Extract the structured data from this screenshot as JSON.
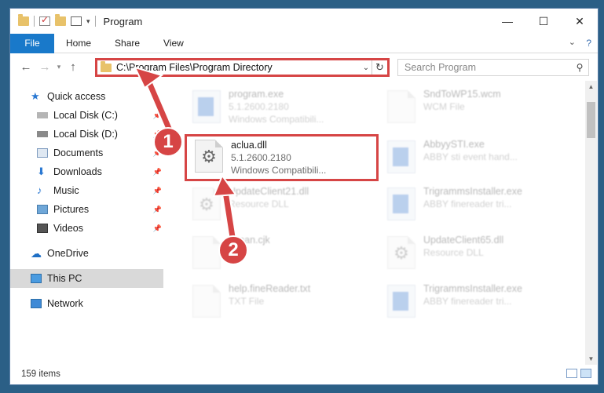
{
  "window": {
    "title": "Program",
    "buttons": {
      "minimize": "—",
      "maximize": "☐",
      "close": "✕"
    }
  },
  "ribbon": {
    "tabs": [
      "File",
      "Home",
      "Share",
      "View"
    ],
    "help": "?"
  },
  "address": {
    "path": "C:\\Program Files\\Program Directory",
    "search_placeholder": "Search Program"
  },
  "sidebar": {
    "items": [
      {
        "label": "Quick access",
        "icon": "star-icon"
      },
      {
        "label": "Local Disk (C:)",
        "icon": "drive-icon"
      },
      {
        "label": "Local Disk (D:)",
        "icon": "drive-icon"
      },
      {
        "label": "Documents",
        "icon": "documents-icon"
      },
      {
        "label": "Downloads",
        "icon": "download-icon"
      },
      {
        "label": "Music",
        "icon": "music-icon"
      },
      {
        "label": "Pictures",
        "icon": "pictures-icon"
      },
      {
        "label": "Videos",
        "icon": "videos-icon"
      },
      {
        "label": "OneDrive",
        "icon": "cloud-icon"
      },
      {
        "label": "This PC",
        "icon": "computer-icon"
      },
      {
        "label": "Network",
        "icon": "network-icon"
      }
    ]
  },
  "files": [
    {
      "name": "program.exe",
      "line1": "5.1.2600.2180",
      "line2": "Windows Compatibili...",
      "kind": "app"
    },
    {
      "name": "SndToWP15.wcm",
      "line1": "WCM File",
      "line2": "",
      "kind": "doc"
    },
    {
      "name": "aclua.dll",
      "line1": "5.1.2600.2180",
      "line2": "Windows Compatibili...",
      "kind": "dll"
    },
    {
      "name": "AbbyySTI.exe",
      "line1": "ABBY sti event hand...",
      "line2": "",
      "kind": "app"
    },
    {
      "name": "UpdateClient21.dll",
      "line1": "Resource DLL",
      "line2": "",
      "kind": "dll"
    },
    {
      "name": "TrigrammsInstaller.exe",
      "line1": "ABBY finereader tri...",
      "line2": "",
      "kind": "app"
    },
    {
      "name": "finnan.cjk",
      "line1": "File",
      "line2": "",
      "kind": "doc"
    },
    {
      "name": "UpdateClient65.dll",
      "line1": "Resource DLL",
      "line2": "",
      "kind": "dll"
    },
    {
      "name": "help.fineReader.txt",
      "line1": "TXT File",
      "line2": "",
      "kind": "doc"
    },
    {
      "name": "TrigrammsInstaller.exe",
      "line1": "ABBY finereader tri...",
      "line2": "",
      "kind": "app"
    }
  ],
  "status": {
    "count": "159 items"
  },
  "annotations": {
    "step1": "1",
    "step2": "2",
    "color": "#d64545"
  }
}
